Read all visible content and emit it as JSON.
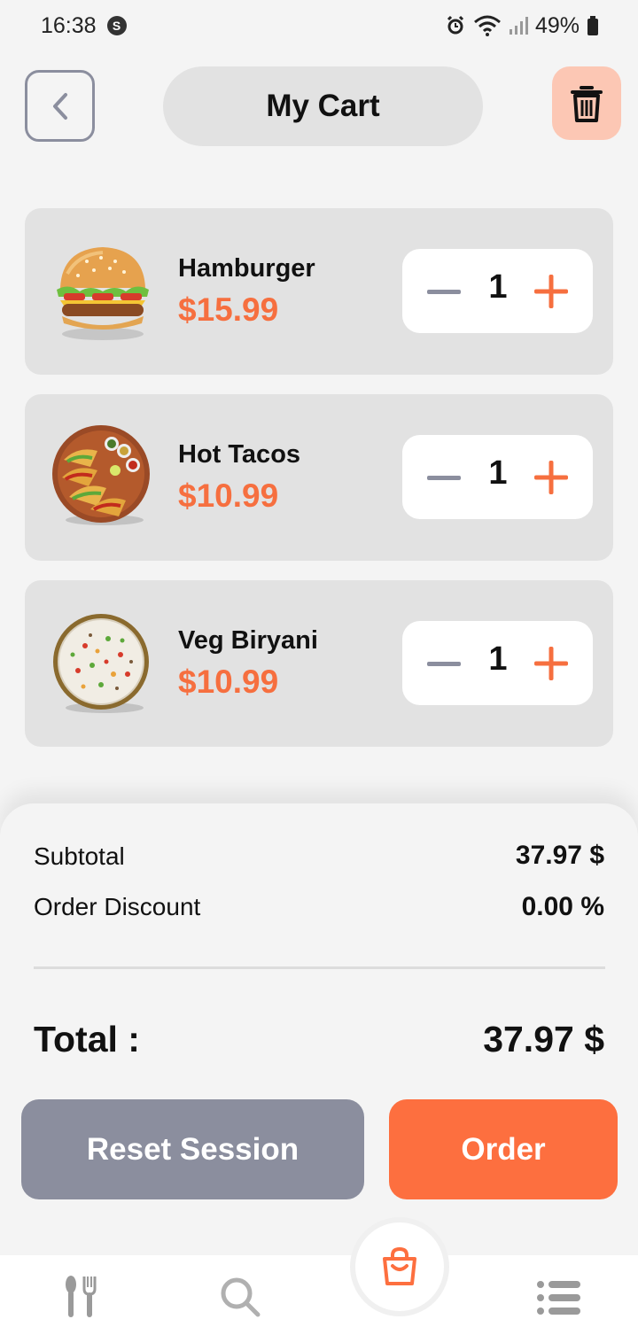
{
  "status_bar": {
    "time": "16:38",
    "app_badge": "S",
    "battery": "49%"
  },
  "header": {
    "title": "My Cart"
  },
  "cart": {
    "items": [
      {
        "name": "Hamburger",
        "price": "$15.99",
        "quantity": "1",
        "image": "hamburger"
      },
      {
        "name": "Hot Tacos",
        "price": "$10.99",
        "quantity": "1",
        "image": "tacos"
      },
      {
        "name": "Veg Biryani",
        "price": "$10.99",
        "quantity": "1",
        "image": "biryani"
      }
    ]
  },
  "summary": {
    "subtotal_label": "Subtotal",
    "subtotal_value": "37.97 $",
    "discount_label": "Order Discount",
    "discount_value": "0.00 %",
    "total_label": "Total :",
    "total_value": "37.97 $"
  },
  "actions": {
    "reset_label": "Reset Session",
    "order_label": "Order"
  },
  "nav": {
    "items": [
      "menu-icon",
      "search-icon",
      "cart-bag-icon",
      "list-icon"
    ]
  },
  "colors": {
    "accent": "#fd6f3f",
    "price": "#f66f3f",
    "secondary": "#8b8e9e",
    "card": "#e2e2e2",
    "trash_bg": "#fcc7b4"
  }
}
